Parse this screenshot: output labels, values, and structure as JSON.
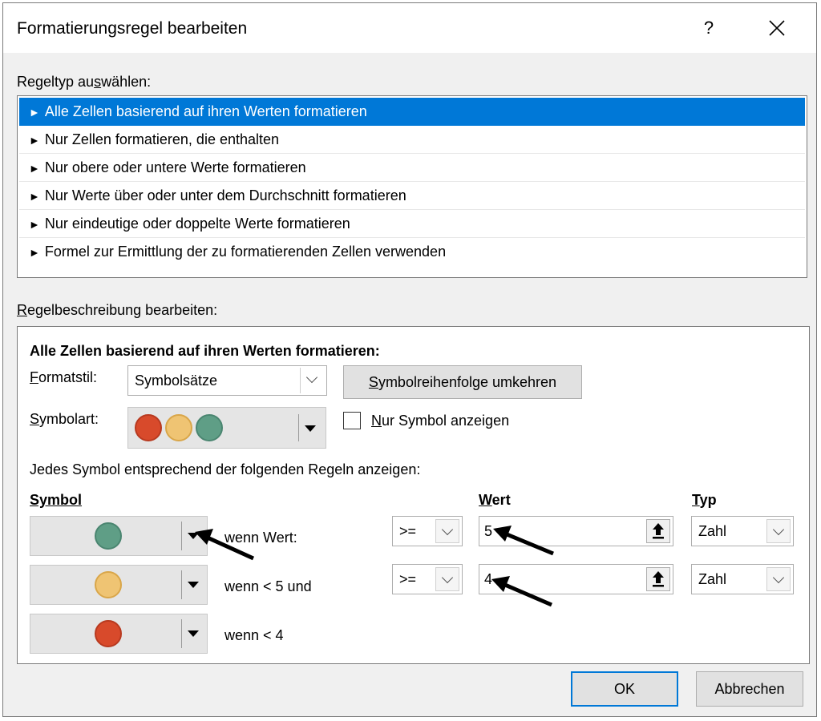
{
  "window": {
    "title": "Formatierungsregel bearbeiten",
    "help_label": "?"
  },
  "rule_type": {
    "label_pre": "Regeltyp au",
    "label_u": "s",
    "label_post": "wählen:",
    "items": [
      {
        "label": "Alle Zellen basierend auf ihren Werten formatieren",
        "selected": true
      },
      {
        "label": "Nur Zellen formatieren, die enthalten",
        "selected": false
      },
      {
        "label": "Nur obere oder untere Werte formatieren",
        "selected": false
      },
      {
        "label": "Nur Werte über oder unter dem Durchschnitt formatieren",
        "selected": false
      },
      {
        "label": "Nur eindeutige oder doppelte Werte formatieren",
        "selected": false
      },
      {
        "label": "Formel zur Ermittlung der zu formatierenden Zellen verwenden",
        "selected": false
      }
    ],
    "arrow_glyph": "►"
  },
  "description": {
    "label_u": "R",
    "label_post": "egelbeschreibung bearbeiten:",
    "heading": "Alle Zellen basierend auf ihren Werten formatieren:",
    "format_style_label_u": "F",
    "format_style_label_post": "ormatstil:",
    "format_style_value": "Symbolsätze",
    "reverse_button_u": "S",
    "reverse_button_post": "ymbolreihenfolge umkehren",
    "symbol_type_label_u": "S",
    "symbol_type_label_post": "ymbolart:",
    "symbol_only_label_u": "N",
    "symbol_only_label_post": "ur Symbol anzeigen",
    "symbol_only_checked": false,
    "rules_intro": "Jedes Symbol entsprechend der folgenden Regeln anzeigen:",
    "col_symbol": "Symbol",
    "col_value_u": "W",
    "col_value_post": "ert",
    "col_type_u": "T",
    "col_type_post": "yp",
    "rows": [
      {
        "icon_color": "#5f9e86",
        "condition": "wenn Wert:",
        "operator": ">=",
        "value": "5",
        "type": "Zahl"
      },
      {
        "icon_color": "#efc473",
        "condition": "wenn < 5 und",
        "operator": ">=",
        "value": "4",
        "type": "Zahl"
      },
      {
        "icon_color": "#d84a2b",
        "condition": "wenn < 4"
      }
    ]
  },
  "buttons": {
    "ok": "OK",
    "cancel": "Abbrechen"
  },
  "colors": {
    "selection": "#0078d7",
    "icon_red": "#d84a2b",
    "icon_yellow": "#efc473",
    "icon_green": "#5f9e86"
  }
}
